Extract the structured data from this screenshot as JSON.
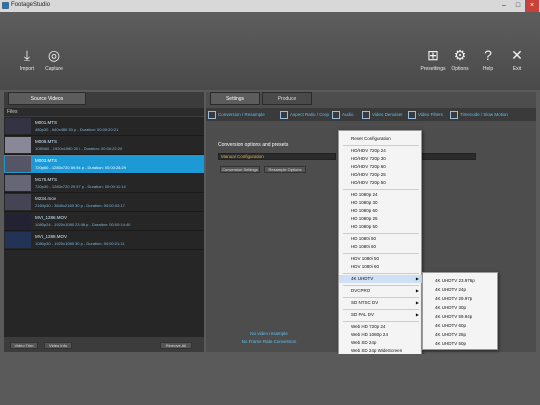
{
  "window": {
    "title": "FootageStudio"
  },
  "toolbar": {
    "left": [
      {
        "label": "Import",
        "icon": "import-icon"
      },
      {
        "label": "Capture",
        "icon": "capture-icon"
      }
    ],
    "right": [
      {
        "label": "Presettings",
        "icon": "grid-icon"
      },
      {
        "label": "Options",
        "icon": "gear-icon"
      },
      {
        "label": "Help",
        "icon": "help-icon"
      },
      {
        "label": "Exit",
        "icon": "close-icon"
      }
    ]
  },
  "left_panel": {
    "tab": "Source Videos",
    "files_header": "Files",
    "files": [
      {
        "name": "M001.MTS",
        "meta": "480p30 - 640x480 30 p - Duration: 00:00:20:21"
      },
      {
        "name": "M008.MTS",
        "meta": "1080i60 - 1920x1080 20 i - Duration: 00:00:22:20"
      },
      {
        "name": "M003.MTS",
        "meta": "720p60 - 1280x720 59.94 p - Duration: 00:00:28:29"
      },
      {
        "name": "M175.MTS",
        "meta": "720p30 - 1280x720 29.97 p - Duration: 00:00:11:14"
      },
      {
        "name": "M234.mov",
        "meta": "2160p30 - 3840x2160 30 p - Duration: 00:00:02:17"
      },
      {
        "name": "MVI_1286.MOV",
        "meta": "1080p24 - 1920x1080 23.98 p - Duration: 00:00:14:40"
      },
      {
        "name": "MVI_1288.MOV",
        "meta": "1080p30 - 1920x1080 30 p - Duration: 00:00:21:11"
      }
    ],
    "buttons": {
      "trim": "Video Trim",
      "info": "Video Info",
      "remove": "Remove All"
    }
  },
  "right_panel": {
    "tabs": [
      "Settings",
      "Produce"
    ],
    "subtabs": [
      "Conversion / Resample",
      "Aspect Ratio / Crop",
      "Audio",
      "Video Denoiser",
      "Video Filters",
      "Timecode / Slow Motion"
    ],
    "conversion_title": "Conversion options and presets",
    "manual_configuration": "Manual Configuration",
    "buttons": {
      "conv_settings": "Conversion Settings",
      "resample_options": "Resample Options"
    },
    "bottom_info": [
      "No video resample",
      "No Frame Rate Conversion"
    ]
  },
  "menu": {
    "items": [
      "Reset Configuration",
      "HD/HDV 720p 24",
      "HD/HDV 720p 30",
      "HD/HDV 720p 60",
      "HD/HDV 720p 25",
      "HD/HDV 720p 50",
      "HD 1080p 24",
      "HD 1080p 30",
      "HD 1080p 60",
      "HD 1080p 25",
      "HD 1080p 50",
      "HD 1080i 50",
      "HD 1080i 60",
      "HDV 1080i 50",
      "HDV 1080i 60",
      "4K UHDTV",
      "DVCPRO",
      "SD NTSC DV",
      "SD PAL DV",
      "Web HD 720p 24",
      "Web HD 1080p 24",
      "Web SD 24p",
      "Web SD 24p WideScreen"
    ],
    "submenu": [
      "4K UHDTV 23.976p",
      "4K UHDTV 24p",
      "4K UHDTV 29.97p",
      "4K UHDTV 30p",
      "4K UHDTV 59.94p",
      "4K UHDTV 60p",
      "4K UHDTV 25p",
      "4K UHDTV 50p"
    ]
  }
}
